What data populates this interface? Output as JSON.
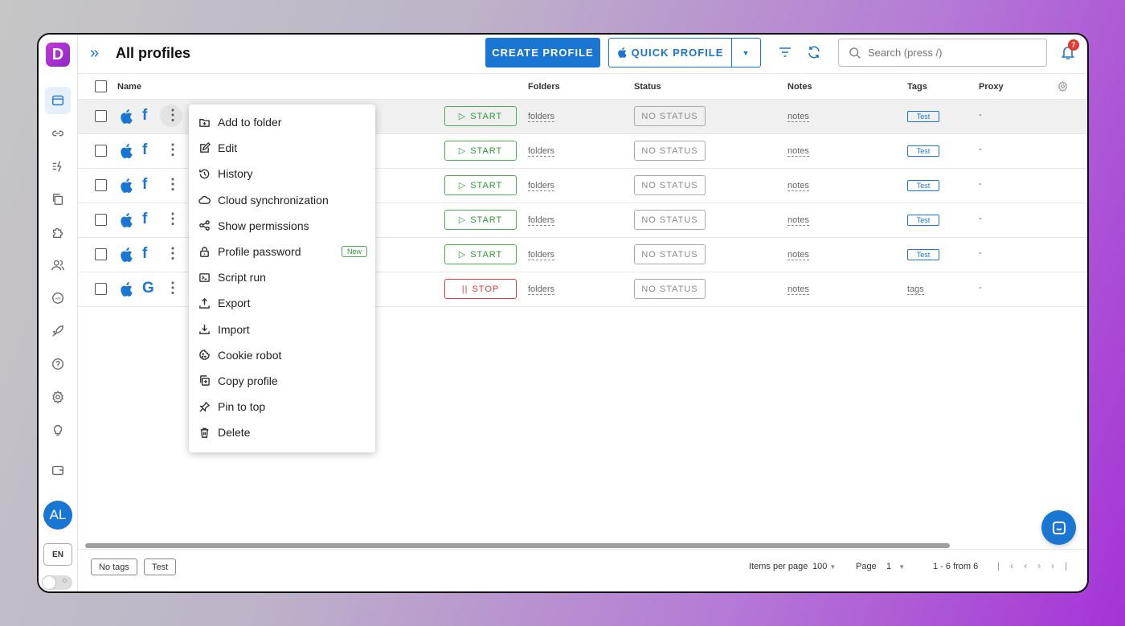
{
  "app": {
    "logo_letter": "D",
    "brand_color": "#1976d2"
  },
  "header": {
    "title": "All profiles",
    "create_label": "CREATE PROFILE",
    "quick_label": "QUICK PROFILE",
    "search_placeholder": "Search (press /)",
    "notification_count": "7"
  },
  "table": {
    "columns": {
      "name": "Name",
      "folders": "Folders",
      "status": "Status",
      "notes": "Notes",
      "tags": "Tags",
      "proxy": "Proxy"
    },
    "rows": [
      {
        "os": "apple-icon",
        "browser": "f",
        "action": "START",
        "folders": "folders",
        "status": "NO STATUS",
        "notes": "notes",
        "tag": "Test",
        "proxy": "-"
      },
      {
        "os": "apple-icon",
        "browser": "f",
        "action": "START",
        "folders": "folders",
        "status": "NO STATUS",
        "notes": "notes",
        "tag": "Test",
        "proxy": "-"
      },
      {
        "os": "apple-icon",
        "browser": "f",
        "action": "START",
        "folders": "folders",
        "status": "NO STATUS",
        "notes": "notes",
        "tag": "Test",
        "proxy": "-"
      },
      {
        "os": "apple-icon",
        "browser": "f",
        "action": "START",
        "folders": "folders",
        "status": "NO STATUS",
        "notes": "notes",
        "tag": "Test",
        "proxy": "-"
      },
      {
        "os": "apple-icon",
        "browser": "f",
        "action": "START",
        "folders": "folders",
        "status": "NO STATUS",
        "notes": "notes",
        "tag": "Test",
        "proxy": "-"
      },
      {
        "os": "apple-icon",
        "browser": "G",
        "action": "STOP",
        "folders": "folders",
        "status": "NO STATUS",
        "notes": "notes",
        "tag": "tags",
        "proxy": "-"
      }
    ]
  },
  "context_menu": {
    "items": [
      "Add to folder",
      "Edit",
      "History",
      "Cloud synchronization",
      "Show permissions",
      "Profile password",
      "Script run",
      "Export",
      "Import",
      "Cookie robot",
      "Copy profile",
      "Pin to top",
      "Delete"
    ],
    "new_badge": "New"
  },
  "sidebar": {
    "avatar": "AL",
    "language": "EN"
  },
  "footer": {
    "chip_no_tags": "No tags",
    "chip_test": "Test",
    "items_per_page_label": "Items per page",
    "items_per_page": "100",
    "page_label": "Page",
    "page": "1",
    "range": "1 - 6 from 6"
  }
}
